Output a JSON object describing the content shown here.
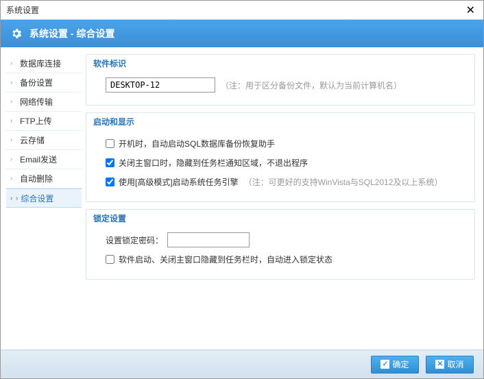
{
  "window": {
    "title": "系统设置"
  },
  "header": {
    "title": "系统设置 - 综合设置"
  },
  "sidebar": {
    "items": [
      {
        "label": "数据库连接"
      },
      {
        "label": "备份设置"
      },
      {
        "label": "网络传输"
      },
      {
        "label": "FTP上传"
      },
      {
        "label": "云存储"
      },
      {
        "label": "Email发送"
      },
      {
        "label": "自动删除"
      },
      {
        "label": "综合设置"
      }
    ]
  },
  "groups": {
    "software_id": {
      "title": "软件标识",
      "value": "DESKTOP-12",
      "hint": "（注：用于区分备份文件，默认为当前计算机名）"
    },
    "startup": {
      "title": "启动和显示",
      "opt1": "开机时，自动启动SQL数据库备份恢复助手",
      "opt2": "关闭主窗口时，隐藏到任务栏通知区域，不退出程序",
      "opt3": "使用[高级模式]启动系统任务引擎",
      "opt3_hint": "（注：可更好的支持WinVista与SQL2012及以上系统）"
    },
    "lock": {
      "title": "锁定设置",
      "pw_label": "设置锁定密码：",
      "pw_value": "",
      "opt1": "软件启动、关闭主窗口隐藏到任务栏时，自动进入锁定状态"
    }
  },
  "footer": {
    "ok": "确定",
    "cancel": "取消"
  }
}
